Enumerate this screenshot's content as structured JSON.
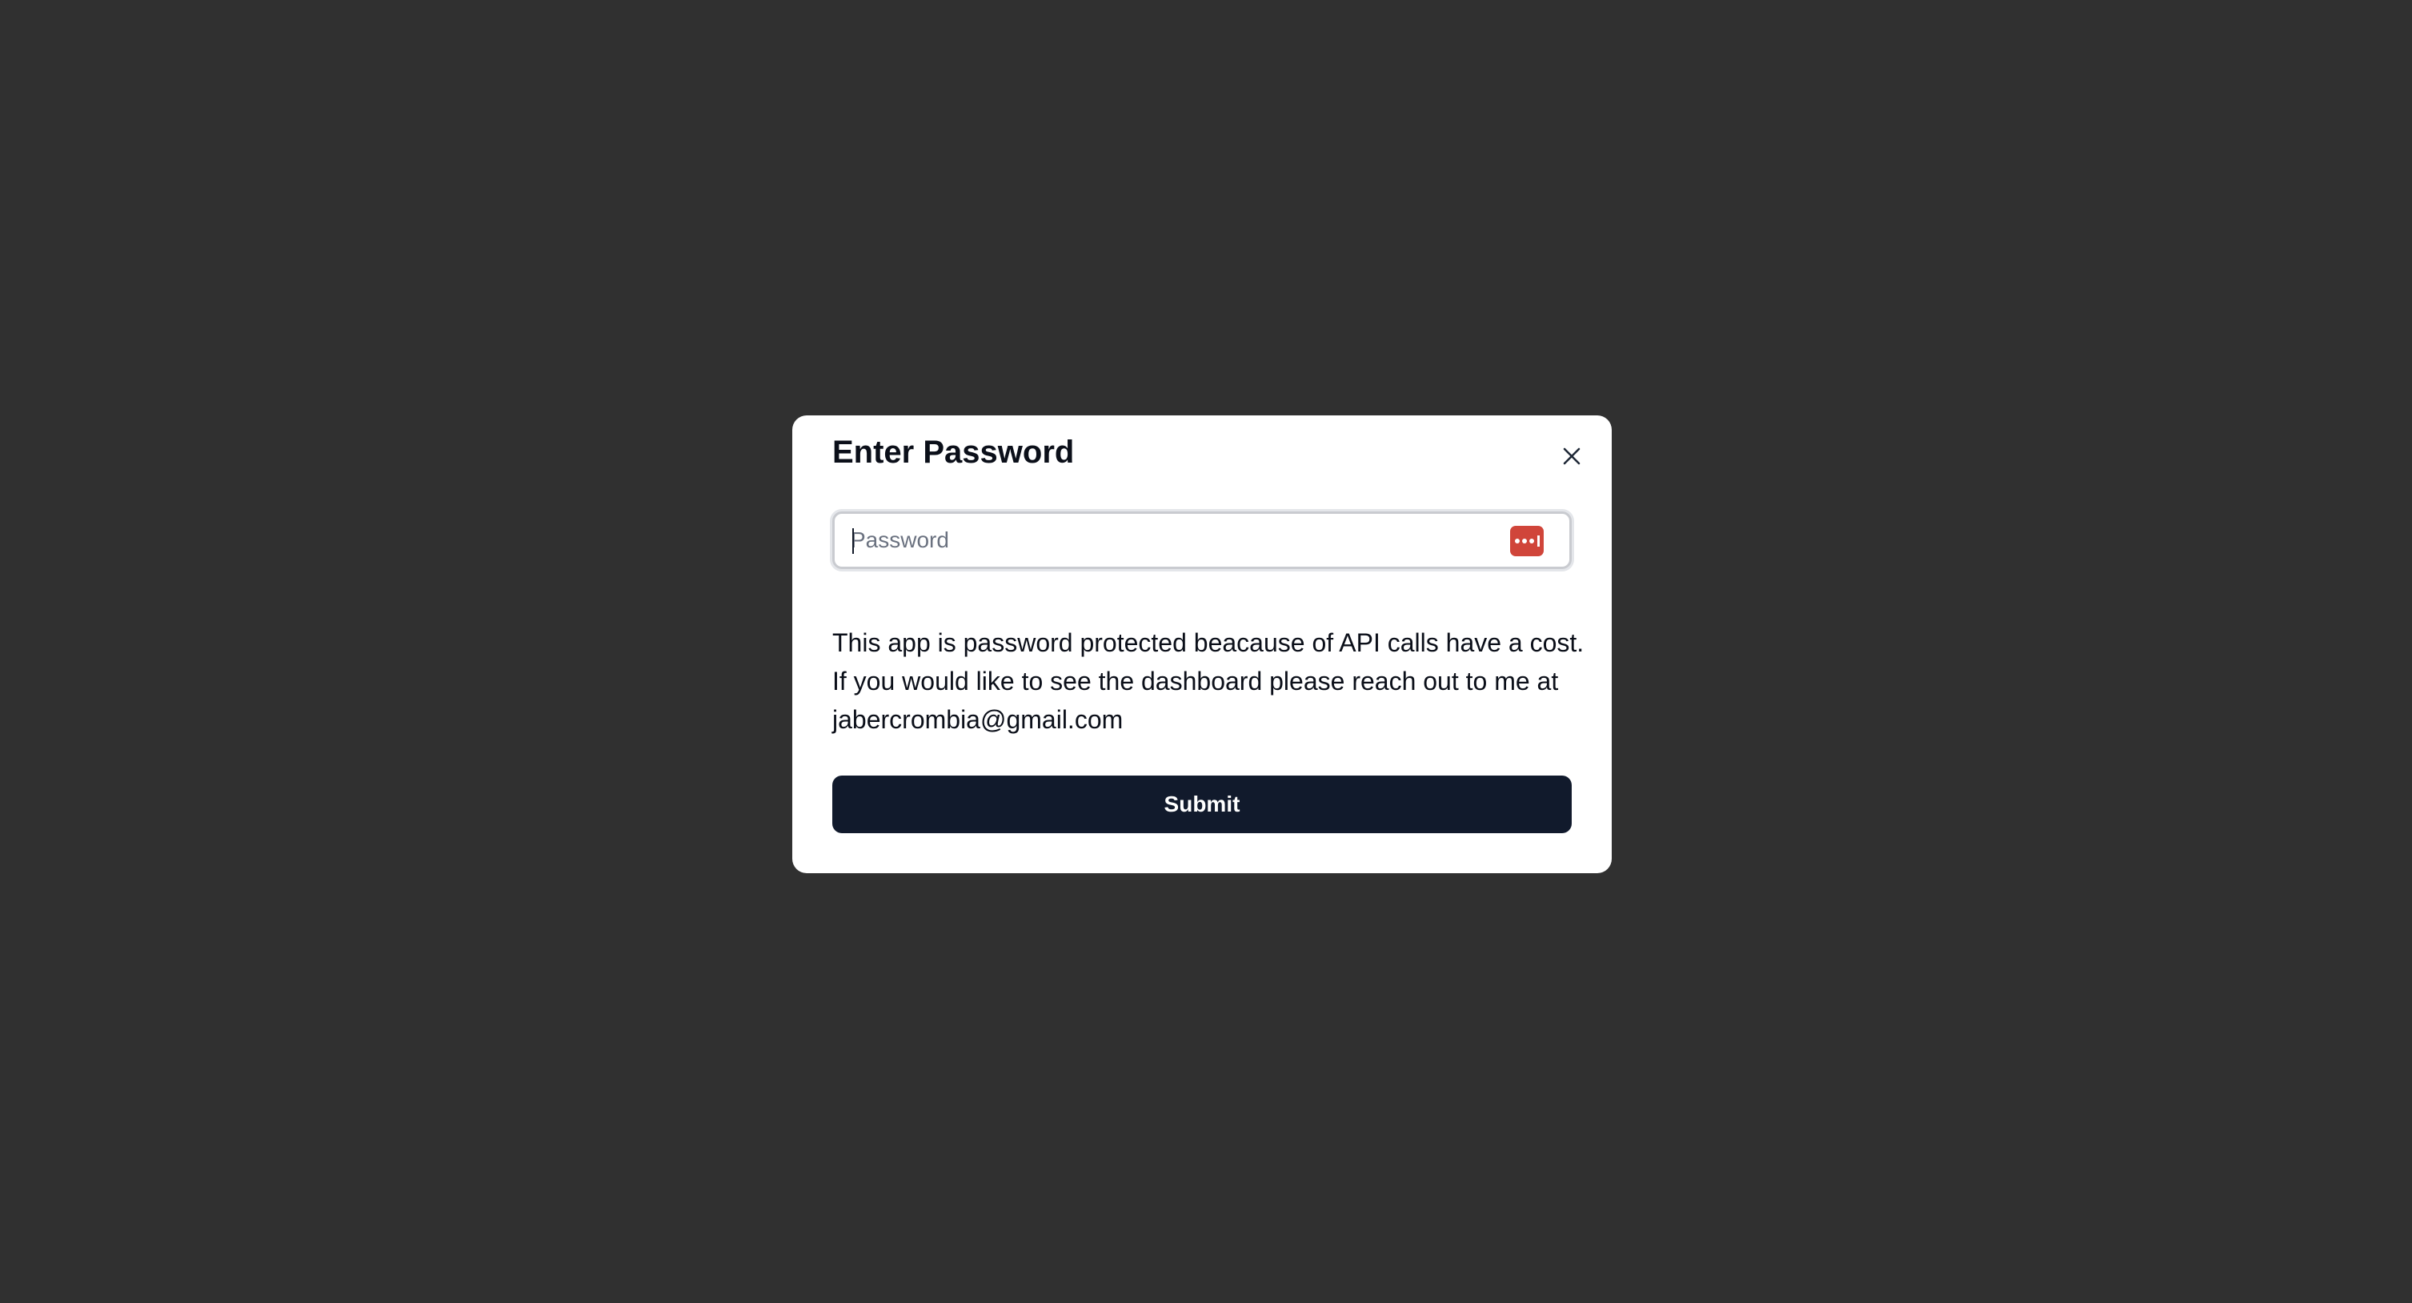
{
  "modal": {
    "title": "Enter Password",
    "close_icon": "close-icon",
    "password_field": {
      "placeholder": "Password",
      "value": "",
      "type": "password"
    },
    "password_manager_icon": "password-manager-icon",
    "description": "This app is password protected beacause of API calls have a cost. If you would like to see the dashboard please reach out to me at jabercrombia@gmail.com",
    "submit_label": "Submit"
  },
  "colors": {
    "backdrop": "#303030",
    "modal_background": "#ffffff",
    "submit_background": "#111a2c",
    "password_manager_accent": "#d0453a"
  }
}
